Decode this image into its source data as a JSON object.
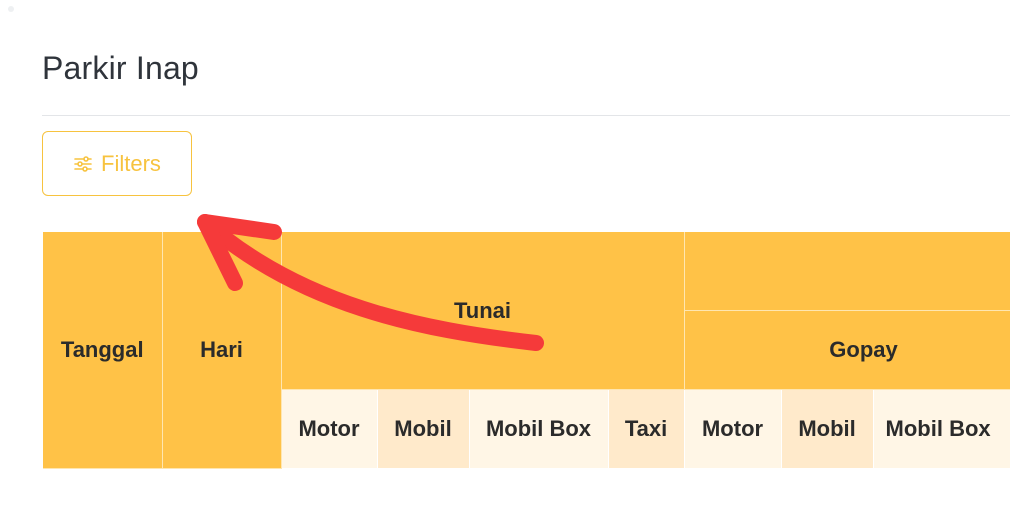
{
  "page": {
    "title": "Parkir Inap"
  },
  "toolbar": {
    "filters_label": "Filters",
    "filters_icon": "sliders-icon",
    "accent_color": "#f7c33f"
  },
  "table": {
    "header_color": "#ffc247",
    "columns": {
      "tanggal": "Tanggal",
      "hari": "Hari"
    },
    "groups": {
      "tunai": "Tunai",
      "gopay": "Gopay"
    },
    "tunai_subcolumns": [
      "Motor",
      "Mobil",
      "Mobil Box",
      "Taxi"
    ],
    "gopay_subcolumns": [
      "Motor",
      "Mobil",
      "Mobil Box"
    ]
  },
  "annotation": {
    "arrow_color": "#f53a3a"
  }
}
